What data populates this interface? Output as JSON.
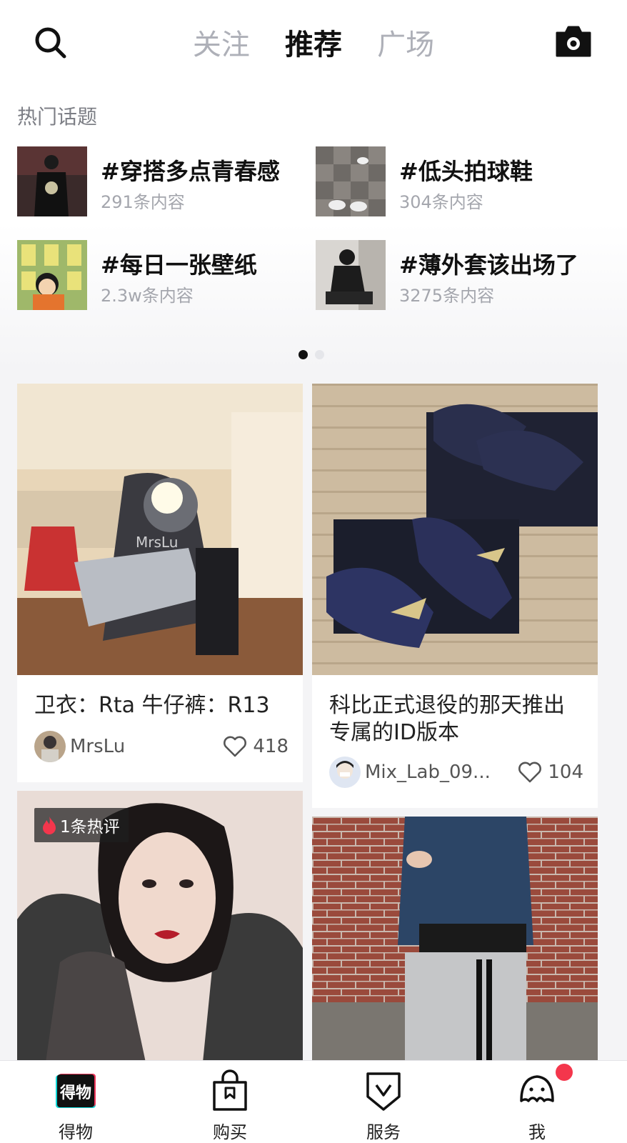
{
  "header": {
    "tabs": [
      {
        "label": "关注",
        "active": false
      },
      {
        "label": "推荐",
        "active": true
      },
      {
        "label": "广场",
        "active": false
      }
    ],
    "search_icon": "search-icon",
    "camera_icon": "camera-icon"
  },
  "hot_topics": {
    "title": "热门话题",
    "items": [
      {
        "name": "#穿搭多点青春感",
        "count": "291条内容"
      },
      {
        "name": "#低头拍球鞋",
        "count": "304条内容"
      },
      {
        "name": "#每日一张壁纸",
        "count": "2.3w条内容"
      },
      {
        "name": "#薄外套该出场了",
        "count": "3275条内容"
      }
    ],
    "page_count": 2,
    "active_page": 0
  },
  "feed": [
    {
      "title": "卫衣：Rta 牛仔裤：R13",
      "author": "MrsLu",
      "likes": "418",
      "watermark": "MrsLu"
    },
    {
      "title": "科比正式退役的那天推出专属的ID版本",
      "author": "Mix_Lab_09...",
      "likes": "104"
    },
    {
      "badge": "1条热评"
    },
    {}
  ],
  "bottom_nav": [
    {
      "label": "得物",
      "icon": "dewu-logo-icon",
      "logo_text": "得物"
    },
    {
      "label": "购买",
      "icon": "shopping-bag-icon"
    },
    {
      "label": "服务",
      "icon": "service-shield-icon"
    },
    {
      "label": "我",
      "icon": "profile-icon",
      "has_badge": true
    }
  ],
  "colors": {
    "accent_red": "#f4364c",
    "text_primary": "#111111",
    "text_muted": "#a4a6ad",
    "tab_inactive": "#aeb0b8"
  }
}
